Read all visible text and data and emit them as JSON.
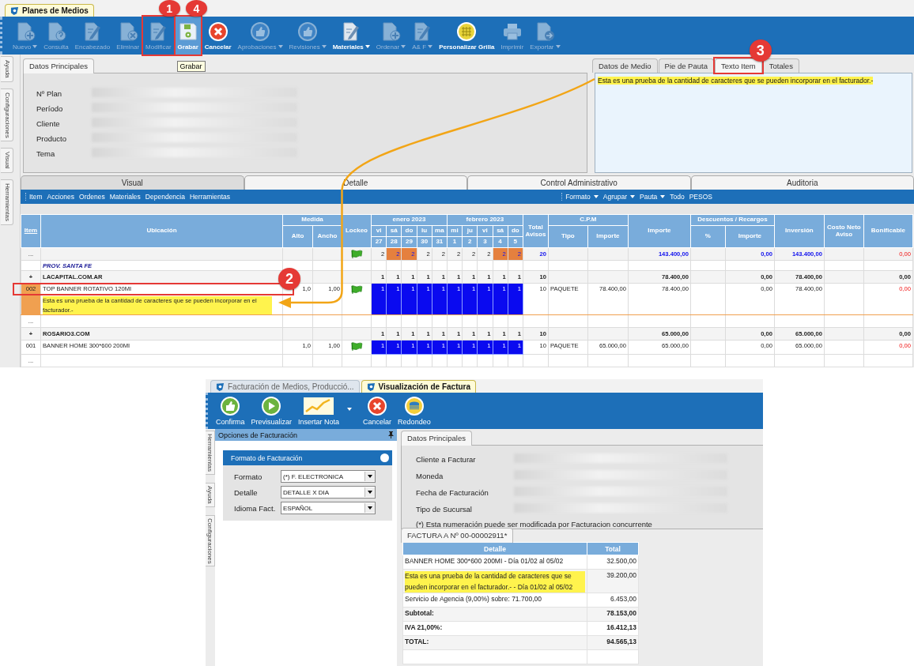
{
  "top_window": {
    "document_tab": "Planes de Medios",
    "toolbar": [
      {
        "kind": "doc-plus",
        "label": "Nuevo",
        "dropdown": true,
        "disabled": true,
        "selected": false
      },
      {
        "kind": "doc-question",
        "label": "Consulta",
        "dropdown": false,
        "disabled": true,
        "selected": false
      },
      {
        "kind": "doc-pencil",
        "label": "Encabezado",
        "dropdown": false,
        "disabled": true,
        "selected": false
      },
      {
        "kind": "doc-x",
        "label": "Eliminar",
        "dropdown": false,
        "disabled": true,
        "selected": false
      },
      {
        "kind": "doc-pencil",
        "label": "Modificar",
        "dropdown": false,
        "disabled": true,
        "selected": false,
        "callout": "1"
      },
      {
        "kind": "save",
        "label": "Grabar",
        "dropdown": false,
        "disabled": false,
        "selected": true,
        "callout": "4",
        "tooltip": "Grabar"
      },
      {
        "kind": "cancel",
        "label": "Cancelar",
        "dropdown": false,
        "disabled": false,
        "selected": false
      },
      {
        "kind": "thumb",
        "label": "Aprobaciones",
        "dropdown": true,
        "disabled": true,
        "selected": false
      },
      {
        "kind": "thumb",
        "label": "Revisiones",
        "dropdown": true,
        "disabled": true,
        "selected": false
      },
      {
        "kind": "doc-pencil",
        "label": "Materiales",
        "dropdown": true,
        "disabled": false,
        "selected": false
      },
      {
        "kind": "doc-plus",
        "label": "Ordenar",
        "dropdown": true,
        "disabled": true,
        "selected": false
      },
      {
        "kind": "doc-pencil",
        "label": "A& F",
        "dropdown": true,
        "disabled": true,
        "selected": false
      },
      {
        "kind": "grid",
        "label": "Personalizar Grilla",
        "dropdown": false,
        "disabled": false,
        "selected": false
      },
      {
        "kind": "printer",
        "label": "Imprimir",
        "dropdown": false,
        "disabled": true,
        "selected": false
      },
      {
        "kind": "doc-arrow",
        "label": "Exportar",
        "dropdown": true,
        "disabled": true,
        "selected": false
      }
    ],
    "side_tabs": [
      "Ayuda",
      "Configuraciones",
      "Visual",
      "Herramientas"
    ],
    "main_data": {
      "tab": "Datos Principales",
      "fields": [
        "Nº Plan",
        "Período",
        "Cliente",
        "Producto",
        "Tema"
      ]
    },
    "detail_tabs": [
      {
        "label": "Datos de Medio",
        "selected": false
      },
      {
        "label": "Pie de Pauta",
        "selected": false
      },
      {
        "label": "Texto Item",
        "selected": true,
        "callout": "3"
      },
      {
        "label": "Totales",
        "selected": false
      }
    ],
    "item_text": "Esta es una prueba de la cantidad de caracteres que se pueden incorporar en el facturador.-",
    "section_tabs": [
      {
        "label": "Visual",
        "selected": true
      },
      {
        "label": "Detalle",
        "selected": false
      },
      {
        "label": "Control Administrativo",
        "selected": false
      },
      {
        "label": "Auditoria",
        "selected": false
      }
    ],
    "menu_left": [
      "Item",
      "Acciones",
      "Ordenes",
      "Materiales",
      "Dependencia",
      "Herramientas"
    ],
    "menu_right": [
      {
        "label": "Formato",
        "dropdown": true
      },
      {
        "label": "Agrupar",
        "dropdown": true
      },
      {
        "label": "Pauta",
        "dropdown": true
      },
      {
        "label": "Todo",
        "dropdown": false
      },
      {
        "label": "PESOS",
        "dropdown": false
      }
    ],
    "grid": {
      "item_header": "Item",
      "location_header": "Ubicación",
      "size_group": {
        "label": "Medida",
        "columns": [
          "Alto",
          "Ancho"
        ]
      },
      "lock_header": "Lockeo",
      "months": [
        {
          "label": "enero 2023",
          "days": [
            {
              "name": "vi",
              "number": "27"
            },
            {
              "name": "sá",
              "number": "28"
            },
            {
              "name": "do",
              "number": "29"
            },
            {
              "name": "lu",
              "number": "30"
            },
            {
              "name": "ma",
              "number": "31"
            }
          ]
        },
        {
          "label": "febrero 2023",
          "days": [
            {
              "name": "mi",
              "number": "1"
            },
            {
              "name": "ju",
              "number": "2"
            },
            {
              "name": "vi",
              "number": "3"
            },
            {
              "name": "sá",
              "number": "4"
            },
            {
              "name": "do",
              "number": "5"
            }
          ]
        }
      ],
      "total_header": "Total Avisos",
      "cpm_group": {
        "label": "C.P.M",
        "columns": [
          "Tipo",
          "Importe"
        ]
      },
      "amount_header": "Importe",
      "discount_group": {
        "label": "Descuentos / Recargos",
        "columns": [
          "%",
          "Importe"
        ]
      },
      "investment_header": "Inversión",
      "net_cost_header": "Costo Neto Aviso",
      "bonus_header": "Bonificable",
      "rows": [
        {
          "kind": "summary",
          "item": "...",
          "locked": true,
          "days": [
            {
              "value": "2",
              "highlighted": false
            },
            {
              "value": "2",
              "highlighted": true
            },
            {
              "value": "2",
              "highlighted": true
            },
            {
              "value": "2",
              "highlighted": false
            },
            {
              "value": "2",
              "highlighted": false
            },
            {
              "value": "2",
              "highlighted": false
            },
            {
              "value": "2",
              "highlighted": false
            },
            {
              "value": "2",
              "highlighted": false
            },
            {
              "value": "2",
              "highlighted": true
            },
            {
              "value": "2",
              "highlighted": true
            }
          ],
          "total": "20",
          "amount": "143.400,00",
          "discount_amount": "0,00",
          "investment": "143.400,00",
          "bonus": "0,00"
        },
        {
          "kind": "group",
          "location": "PROV. SANTA FE"
        },
        {
          "kind": "subtotal",
          "item": "+",
          "location": "LACAPITAL.COM.AR",
          "locked": false,
          "days": [
            {
              "value": "1",
              "highlighted": false
            },
            {
              "value": "1",
              "highlighted": false
            },
            {
              "value": "1",
              "highlighted": false
            },
            {
              "value": "1",
              "highlighted": false
            },
            {
              "value": "1",
              "highlighted": false
            },
            {
              "value": "1",
              "highlighted": false
            },
            {
              "value": "1",
              "highlighted": false
            },
            {
              "value": "1",
              "highlighted": false
            },
            {
              "value": "1",
              "highlighted": false
            },
            {
              "value": "1",
              "highlighted": false
            }
          ],
          "total": "10",
          "amount": "78.400,00",
          "discount_amount": "0,00",
          "investment": "78.400,00",
          "bonus": "0,00"
        },
        {
          "kind": "item",
          "item": "002",
          "location": "TOP BANNER ROTATIVO 120MI",
          "note": "Esta es una prueba de la cantidad de caracteres que se pueden incorporar en el facturador.-",
          "selected": true,
          "callout": "2",
          "alto": "1,0",
          "ancho": "1,00",
          "locked": true,
          "days": [
            {
              "value": "1",
              "highlighted": false
            },
            {
              "value": "1",
              "highlighted": false
            },
            {
              "value": "1",
              "highlighted": false
            },
            {
              "value": "1",
              "highlighted": false
            },
            {
              "value": "1",
              "highlighted": false
            },
            {
              "value": "1",
              "highlighted": false
            },
            {
              "value": "1",
              "highlighted": false
            },
            {
              "value": "1",
              "highlighted": false
            },
            {
              "value": "1",
              "highlighted": false
            },
            {
              "value": "1",
              "highlighted": false
            }
          ],
          "total": "10",
          "cpm_type": "PAQUETE",
          "cpm_amount": "78.400,00",
          "amount": "78.400,00",
          "discount_amount": "0,00",
          "investment": "78.400,00",
          "bonus": "0,00"
        },
        {
          "kind": "blank",
          "item": "..."
        },
        {
          "kind": "subtotal",
          "item": "+",
          "location": "ROSARIO3.COM",
          "locked": false,
          "days": [
            {
              "value": "1",
              "highlighted": false
            },
            {
              "value": "1",
              "highlighted": false
            },
            {
              "value": "1",
              "highlighted": false
            },
            {
              "value": "1",
              "highlighted": false
            },
            {
              "value": "1",
              "highlighted": false
            },
            {
              "value": "1",
              "highlighted": false
            },
            {
              "value": "1",
              "highlighted": false
            },
            {
              "value": "1",
              "highlighted": false
            },
            {
              "value": "1",
              "highlighted": false
            },
            {
              "value": "1",
              "highlighted": false
            }
          ],
          "total": "10",
          "amount": "65.000,00",
          "discount_amount": "0,00",
          "investment": "65.000,00",
          "bonus": "0,00"
        },
        {
          "kind": "item",
          "item": "001",
          "location": "BANNER HOME 300*600 200MI",
          "selected": false,
          "alto": "1,0",
          "ancho": "1,00",
          "locked": true,
          "days": [
            {
              "value": "1",
              "highlighted": false
            },
            {
              "value": "1",
              "highlighted": false
            },
            {
              "value": "1",
              "highlighted": false
            },
            {
              "value": "1",
              "highlighted": false
            },
            {
              "value": "1",
              "highlighted": false
            },
            {
              "value": "1",
              "highlighted": false
            },
            {
              "value": "1",
              "highlighted": false
            },
            {
              "value": "1",
              "highlighted": false
            },
            {
              "value": "1",
              "highlighted": false
            },
            {
              "value": "1",
              "highlighted": false
            }
          ],
          "total": "10",
          "cpm_type": "PAQUETE",
          "cpm_amount": "65.000,00",
          "amount": "65.000,00",
          "discount_amount": "0,00",
          "investment": "65.000,00",
          "bonus": "0,00"
        },
        {
          "kind": "blank",
          "item": "..."
        }
      ]
    }
  },
  "bottom_window": {
    "document_tabs": [
      {
        "label": "Facturación de Medios, Producció...",
        "selected": false
      },
      {
        "label": "Visualización de Factura",
        "selected": true
      }
    ],
    "toolbar": [
      {
        "kind": "confirm",
        "label": "Confirma",
        "dropdown": false
      },
      {
        "kind": "preview",
        "label": "Previsualizar",
        "dropdown": false
      },
      {
        "kind": "note",
        "label": "Insertar Nota",
        "dropdown": true
      },
      {
        "kind": "cancel",
        "label": "Cancelar",
        "dropdown": false
      },
      {
        "kind": "round",
        "label": "Redondeo",
        "dropdown": false
      }
    ],
    "side_tabs": [
      "Herramientas",
      "Ayuda",
      "Configuraciones"
    ],
    "options_panel": {
      "title": "Opciones de Facturación",
      "card_title": "Formato de Facturación",
      "fields": [
        {
          "label": "Formato",
          "value": "(*) F. ELECTRONICA"
        },
        {
          "label": "Detalle",
          "value": "DETALLE X DIA"
        },
        {
          "label": "Idioma Fact.",
          "value": "ESPAÑOL"
        }
      ]
    },
    "main_data": {
      "tab": "Datos Principales",
      "fields": [
        "Cliente a Facturar",
        "Moneda",
        "Fecha de Facturación",
        "Tipo de Sucursal"
      ],
      "note": "(*) Esta numeración puede ser modificada por Facturacion concurrente"
    },
    "invoice": {
      "tab": "FACTURA A Nº 00-00002911*",
      "columns": [
        "Detalle",
        "Total"
      ],
      "rows": [
        {
          "detail": "BANNER HOME 300*600 200MI - Día 01/02 al 05/02",
          "total": "32.500,00",
          "highlighted": false,
          "bold": false
        },
        {
          "detail": "Esta es una prueba de la cantidad de caracteres que se pueden incorporar en el facturador.- - Día 01/02 al 05/02",
          "total": "39.200,00",
          "highlighted": true,
          "bold": false
        },
        {
          "detail": "Servicio de Agencia (9,00%) sobre: 71.700,00",
          "total": "6.453,00",
          "highlighted": false,
          "bold": false
        },
        {
          "detail": "Subtotal:",
          "total": "78.153,00",
          "highlighted": false,
          "bold": true
        },
        {
          "detail": "IVA 21,00%:",
          "total": "16.412,13",
          "highlighted": false,
          "bold": true
        },
        {
          "detail": "TOTAL:",
          "total": "94.565,13",
          "highlighted": false,
          "bold": true
        }
      ]
    }
  }
}
